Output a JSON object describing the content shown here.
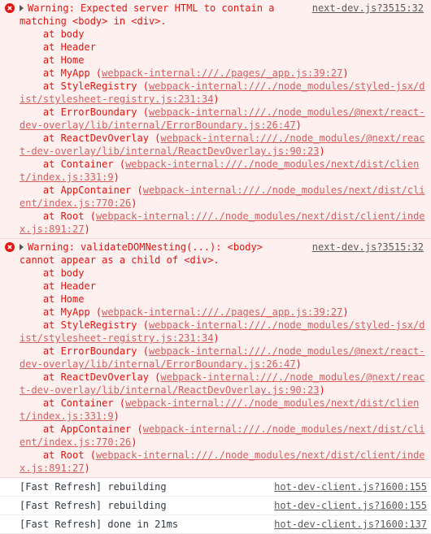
{
  "errors": [
    {
      "head_prefix": "Warning: Expected server HTML to contain a",
      "head_rest": "matching <body> in <div>.",
      "source": "next-dev.js?3515:32",
      "frames": [
        {
          "text": "    at body"
        },
        {
          "text": "    at Header"
        },
        {
          "text": "    at Home"
        },
        {
          "text": "    at MyApp (",
          "link": "webpack-internal:///./pages/_app.js:39:27",
          "end": ")"
        },
        {
          "text": "    at StyleRegistry (",
          "link": "webpack-internal:///./node_modules/styled-jsx/dist/stylesheet-registry.js:231:34",
          "end": ")"
        },
        {
          "text": "    at ErrorBoundary (",
          "link": "webpack-internal:///./node_modules/@next/react-dev-overlay/lib/internal/ErrorBoundary.js:26:47",
          "end": ")"
        },
        {
          "text": "    at ReactDevOverlay (",
          "link": "webpack-internal:///./node_modules/@next/react-dev-overlay/lib/internal/ReactDevOverlay.js:90:23",
          "end": ")"
        },
        {
          "text": "    at Container (",
          "link": "webpack-internal:///./node_modules/next/dist/client/index.js:331:9",
          "end": ")"
        },
        {
          "text": "    at AppContainer (",
          "link": "webpack-internal:///./node_modules/next/dist/client/index.js:770:26",
          "end": ")"
        },
        {
          "text": "    at Root (",
          "link": "webpack-internal:///./node_modules/next/dist/client/index.js:891:27",
          "end": ")"
        }
      ]
    },
    {
      "head_prefix": "Warning: validateDOMNesting(...): <body>",
      "head_rest": "cannot appear as a child of <div>.",
      "source": "next-dev.js?3515:32",
      "frames": [
        {
          "text": "    at body"
        },
        {
          "text": "    at Header"
        },
        {
          "text": "    at Home"
        },
        {
          "text": "    at MyApp (",
          "link": "webpack-internal:///./pages/_app.js:39:27",
          "end": ")"
        },
        {
          "text": "    at StyleRegistry (",
          "link": "webpack-internal:///./node_modules/styled-jsx/dist/stylesheet-registry.js:231:34",
          "end": ")"
        },
        {
          "text": "    at ErrorBoundary (",
          "link": "webpack-internal:///./node_modules/@next/react-dev-overlay/lib/internal/ErrorBoundary.js:26:47",
          "end": ")"
        },
        {
          "text": "    at ReactDevOverlay (",
          "link": "webpack-internal:///./node_modules/@next/react-dev-overlay/lib/internal/ReactDevOverlay.js:90:23",
          "end": ")"
        },
        {
          "text": "    at Container (",
          "link": "webpack-internal:///./node_modules/next/dist/client/index.js:331:9",
          "end": ")"
        },
        {
          "text": "    at AppContainer (",
          "link": "webpack-internal:///./node_modules/next/dist/client/index.js:770:26",
          "end": ")"
        },
        {
          "text": "    at Root (",
          "link": "webpack-internal:///./node_modules/next/dist/client/index.js:891:27",
          "end": ")"
        }
      ]
    }
  ],
  "logs": [
    {
      "text": "[Fast Refresh] rebuilding",
      "source": "hot-dev-client.js?1600:155"
    },
    {
      "text": "[Fast Refresh] rebuilding",
      "source": "hot-dev-client.js?1600:155"
    },
    {
      "text": "[Fast Refresh] done in 21ms",
      "source": "hot-dev-client.js?1600:137"
    }
  ],
  "icons": {
    "error": "error-circle-icon",
    "expand": "expand-triangle-icon"
  },
  "colors": {
    "error_text": "#e1140f",
    "error_bg": "#fff0f0",
    "link": "#d35f5f",
    "log_text": "#303942"
  }
}
